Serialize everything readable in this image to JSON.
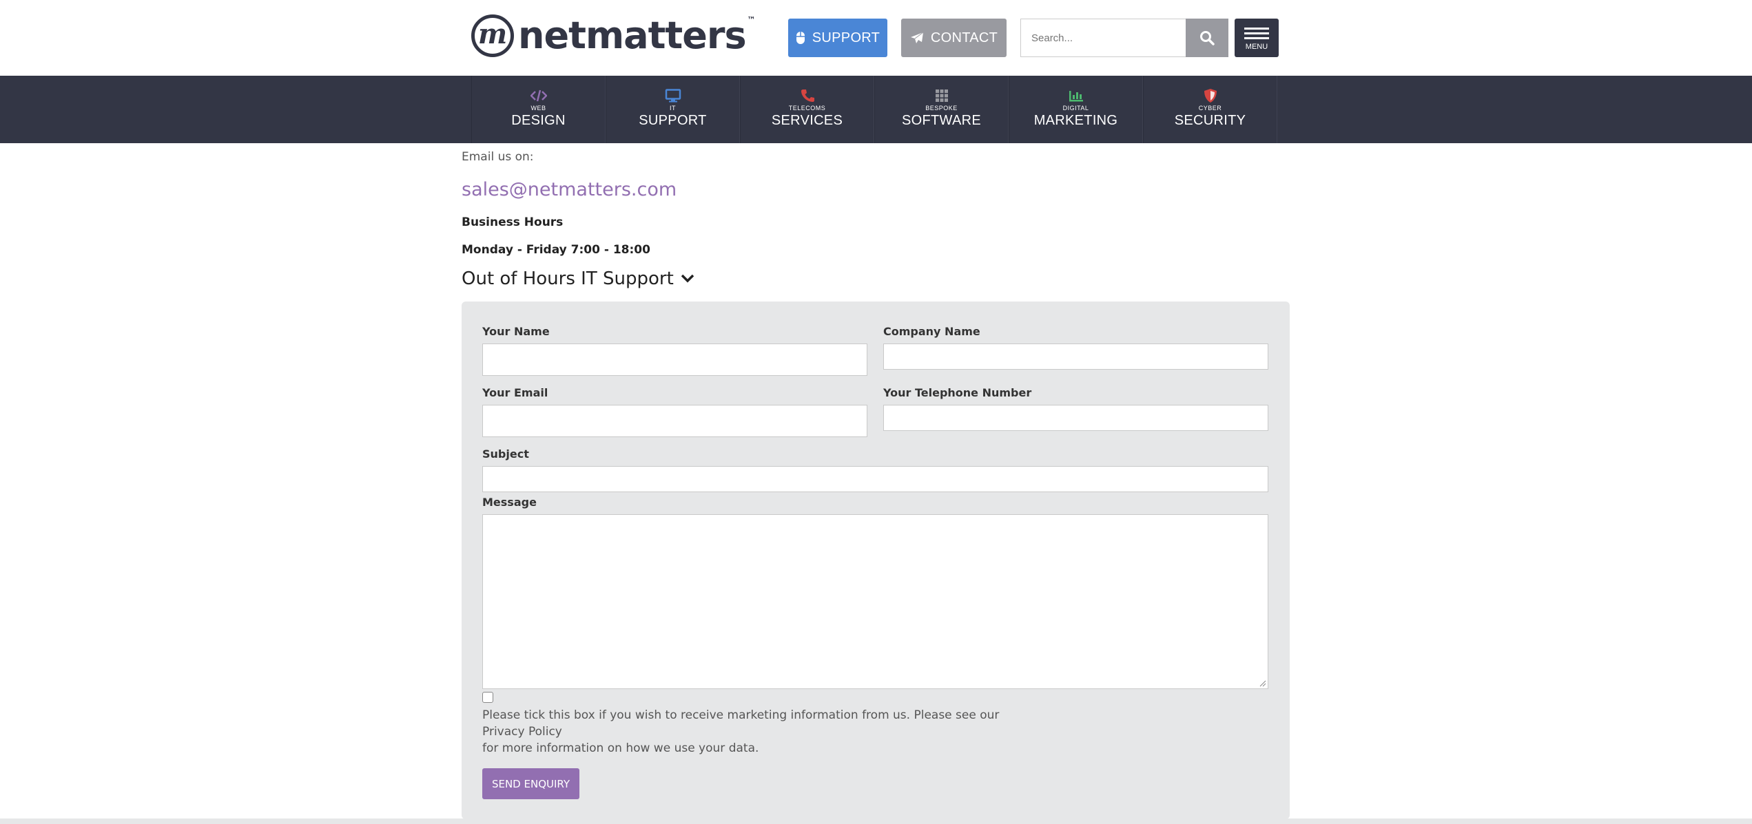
{
  "brand": {
    "logo_text": "netmatters",
    "logo_mark": "m",
    "trademark": "™"
  },
  "header": {
    "support_label": "SUPPORT",
    "contact_label": "CONTACT",
    "search_placeholder": "Search...",
    "menu_label": "MENU",
    "icons": {
      "support": "mouse-icon",
      "contact": "paper-plane-icon",
      "search": "search-icon",
      "menu": "hamburger-icon"
    }
  },
  "nav": {
    "items": [
      {
        "small": "WEB",
        "large": "DESIGN",
        "icon": "code-icon",
        "color": "#926fb1"
      },
      {
        "small": "IT",
        "large": "SUPPORT",
        "icon": "monitor-icon",
        "color": "#4a86d6"
      },
      {
        "small": "TELECOMS",
        "large": "SERVICES",
        "icon": "phone-icon",
        "color": "#d64541"
      },
      {
        "small": "BESPOKE",
        "large": "SOFTWARE",
        "icon": "grid-icon",
        "color": "#999aa0"
      },
      {
        "small": "DIGITAL",
        "large": "MARKETING",
        "icon": "bar-chart-icon",
        "color": "#4dba6f"
      },
      {
        "small": "CYBER",
        "large": "SECURITY",
        "icon": "shield-icon",
        "color": "#d64541"
      }
    ]
  },
  "contact": {
    "email_label": "Email us on:",
    "email": "sales@netmatters.com",
    "hours_title": "Business Hours",
    "hours": "Monday - Friday 7:00 - 18:00",
    "out_of_hours": "Out of Hours IT Support"
  },
  "form": {
    "your_name": "Your Name",
    "company_name": "Company Name",
    "your_email": "Your Email",
    "telephone": "Your Telephone Number",
    "subject": "Subject",
    "message": "Message",
    "marketing_line1": "Please tick this box if you wish to receive marketing information from us. Please see our",
    "privacy_policy": "Privacy Policy",
    "marketing_line3": "for more information on how we use your data.",
    "submit_label": "SEND ENQUIRY"
  },
  "colors": {
    "brand_dark": "#333645",
    "purple": "#926fb1",
    "blue": "#4a86d6",
    "grey": "#999aa0",
    "panel": "#e6e7e8"
  }
}
